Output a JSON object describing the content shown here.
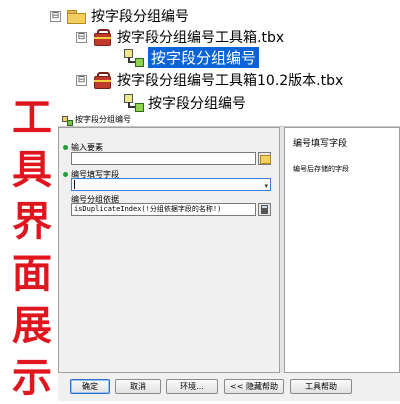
{
  "tree": {
    "root": {
      "label": "按字段分组编号",
      "expander": "⊟"
    },
    "toolbox1": {
      "label": "按字段分组编号工具箱.tbx",
      "expander": "⊟"
    },
    "model1": {
      "label": "按字段分组编号"
    },
    "toolbox2": {
      "label": "按字段分组编号工具箱10.2版本.tbx",
      "expander": "⊟"
    },
    "model2": {
      "label": "按字段分组编号"
    }
  },
  "caption": {
    "chars": [
      "工",
      "具",
      "界",
      "面",
      "展",
      "示"
    ],
    "color": "#e0161e"
  },
  "dialog": {
    "title": "按字段分组编号",
    "fields": {
      "input_features": {
        "label": "输入要素",
        "value": ""
      },
      "number_field": {
        "label": "编号填写字段",
        "value": ""
      },
      "group_by": {
        "label": "编号分组依据",
        "value": "isDuplicateIndex(!分组依据字段的名称!)"
      }
    },
    "help": {
      "title": "编号填写字段",
      "text": "编号后存储的字段"
    },
    "buttons": {
      "ok": "确定",
      "cancel": "取消",
      "env": "环境...",
      "hide_help": "<< 隐藏帮助",
      "tool_help": "工具帮助"
    }
  },
  "colors": {
    "selection": "#0a64d8",
    "required_marker": "#1f9e3a",
    "toolbox_icon": "#c0392b",
    "folder_icon": "#f3cf62"
  },
  "icons": [
    "folder-icon",
    "toolbox-icon",
    "model-tool-icon",
    "browse-folder-icon",
    "calculator-icon",
    "required-dot-icon",
    "dropdown-arrow-icon"
  ]
}
